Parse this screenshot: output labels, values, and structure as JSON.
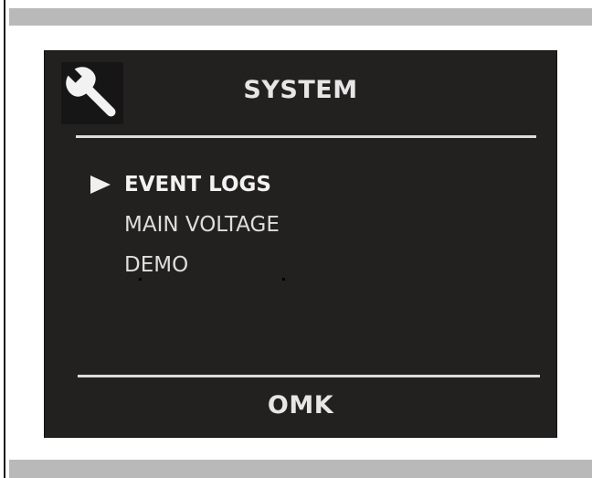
{
  "screen": {
    "title": "SYSTEM",
    "icon": "wrench-icon",
    "footer_label": "OMK"
  },
  "menu": {
    "items": [
      {
        "label": "EVENT LOGS",
        "selected": true
      },
      {
        "label": "MAIN VOLTAGE",
        "selected": false
      },
      {
        "label": "DEMO",
        "selected": false
      }
    ]
  },
  "colors": {
    "screen_background": "#232120",
    "text": "#e6e6e6",
    "frame_bars": "#b9b9b9"
  }
}
